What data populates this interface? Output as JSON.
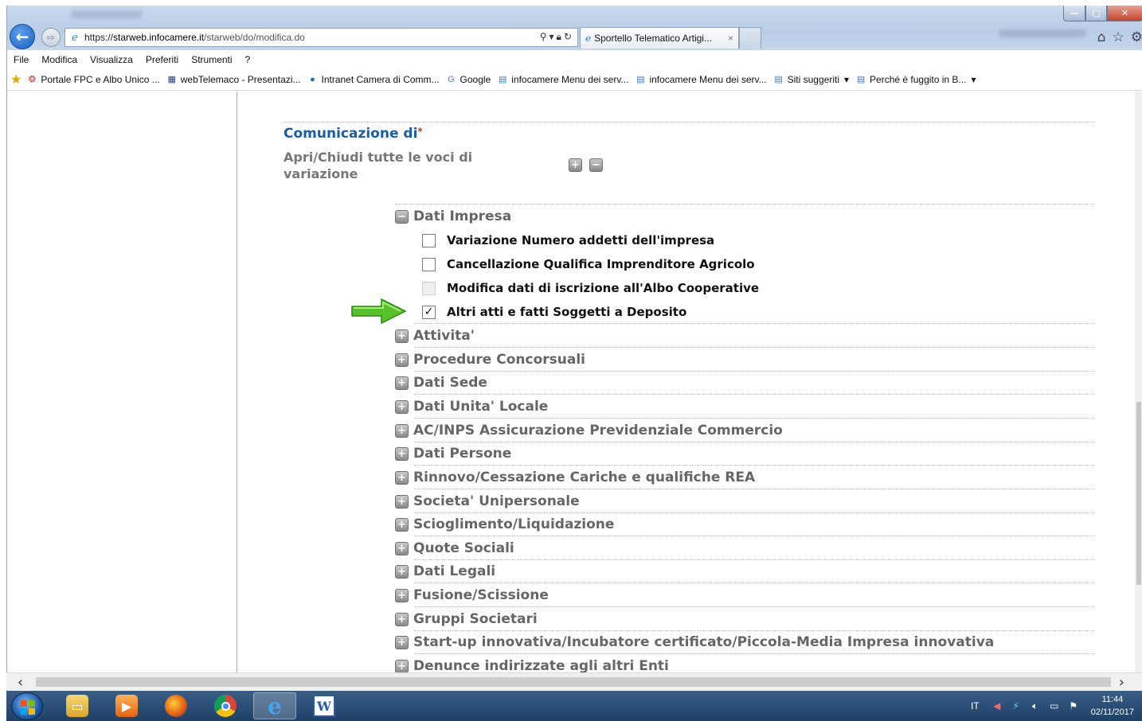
{
  "browser": {
    "address": {
      "protocol": "https://",
      "host": "starweb.infocamere.it",
      "path": "/starweb/do/modifica.do"
    },
    "tab_title": "Sportello Telematico Artigi...",
    "tab_close": "×"
  },
  "menu": [
    "File",
    "Modifica",
    "Visualizza",
    "Preferiti",
    "Strumenti",
    "?"
  ],
  "favorites": [
    {
      "label": "Portale FPC e Albo Unico ...",
      "icon": "globe-red-icon"
    },
    {
      "label": "webTelemaco - Presentazi...",
      "icon": "grid-icon"
    },
    {
      "label": "Intranet Camera di Comm...",
      "icon": "globe-icon"
    },
    {
      "label": "Google",
      "icon": "google-icon"
    },
    {
      "label": "infocamere Menu dei serv...",
      "icon": "page-icon"
    },
    {
      "label": "infocamere Menu dei serv...",
      "icon": "page-icon"
    },
    {
      "label": "Siti suggeriti",
      "icon": "page-icon",
      "dropdown": true
    },
    {
      "label": "Perché è fuggito in B...",
      "icon": "page-icon",
      "dropdown": true
    }
  ],
  "form": {
    "title": "Comunicazione di",
    "required_mark": "*",
    "toggle_all_label": "Apri/Chiudi tutte le voci di variazione",
    "expanded_section": {
      "label": "Dati Impresa",
      "options": [
        {
          "label": "Variazione Numero addetti dell'impresa",
          "checked": false,
          "disabled": false
        },
        {
          "label": "Cancellazione Qualifica Imprenditore Agricolo",
          "checked": false,
          "disabled": false
        },
        {
          "label": "Modifica dati di iscrizione all'Albo Cooperative",
          "checked": false,
          "disabled": true
        },
        {
          "label": "Altri atti e fatti Soggetti a Deposito",
          "checked": true,
          "disabled": false
        }
      ]
    },
    "collapsed_sections": [
      "Attivita'",
      "Procedure Concorsuali",
      "Dati Sede",
      "Dati Unita' Locale",
      "AC/INPS Assicurazione Previdenziale Commercio",
      "Dati Persone",
      "Rinnovo/Cessazione Cariche e qualifiche REA",
      "Societa' Unipersonale",
      "Scioglimento/Liquidazione",
      "Quote Sociali",
      "Dati Legali",
      "Fusione/Scissione",
      "Gruppi Societari",
      "Start-up innovativa/Incubatore certificato/Piccola-Media Impresa innovativa",
      "Denunce indirizzate agli altri Enti"
    ]
  },
  "taskbar": {
    "language": "IT",
    "time": "11:44",
    "date": "02/11/2017"
  }
}
